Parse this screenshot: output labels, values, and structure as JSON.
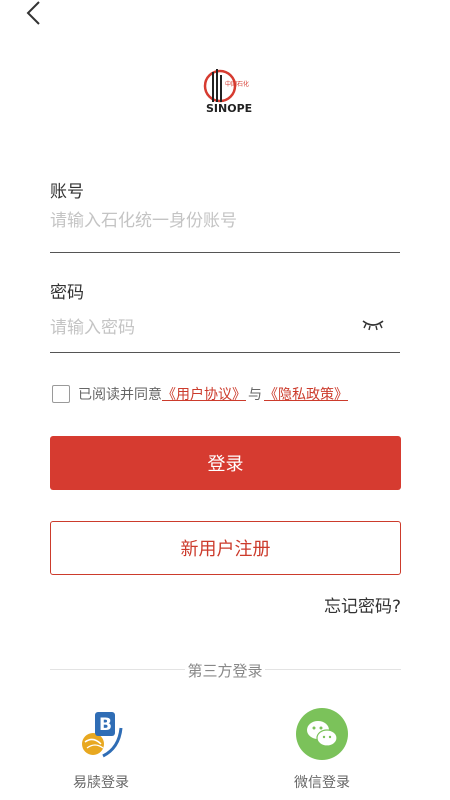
{
  "icons": {
    "back": "chevron-left-icon",
    "logo": "sinopec-logo",
    "eye": "eye-closed-icon",
    "yidu": "yidu-app-icon",
    "wechat": "wechat-icon"
  },
  "colors": {
    "accent": "#d63b30",
    "link": "#cc3b2c",
    "wechat": "#7bc25a"
  },
  "account": {
    "label": "账号",
    "placeholder": "请输入石化统一身份账号",
    "value": ""
  },
  "password": {
    "label": "密码",
    "placeholder": "请输入密码",
    "value": ""
  },
  "agreement": {
    "checked": false,
    "prefix": "已阅读并同意",
    "user_agreement": "《用户协议》",
    "and": "与",
    "privacy_policy": "《隐私政策》"
  },
  "buttons": {
    "login": "登录",
    "register": "新用户注册",
    "forgot_password": "忘记密码?"
  },
  "third_party": {
    "title": "第三方登录",
    "items": [
      {
        "label": "易牍登录"
      },
      {
        "label": "微信登录"
      }
    ]
  }
}
